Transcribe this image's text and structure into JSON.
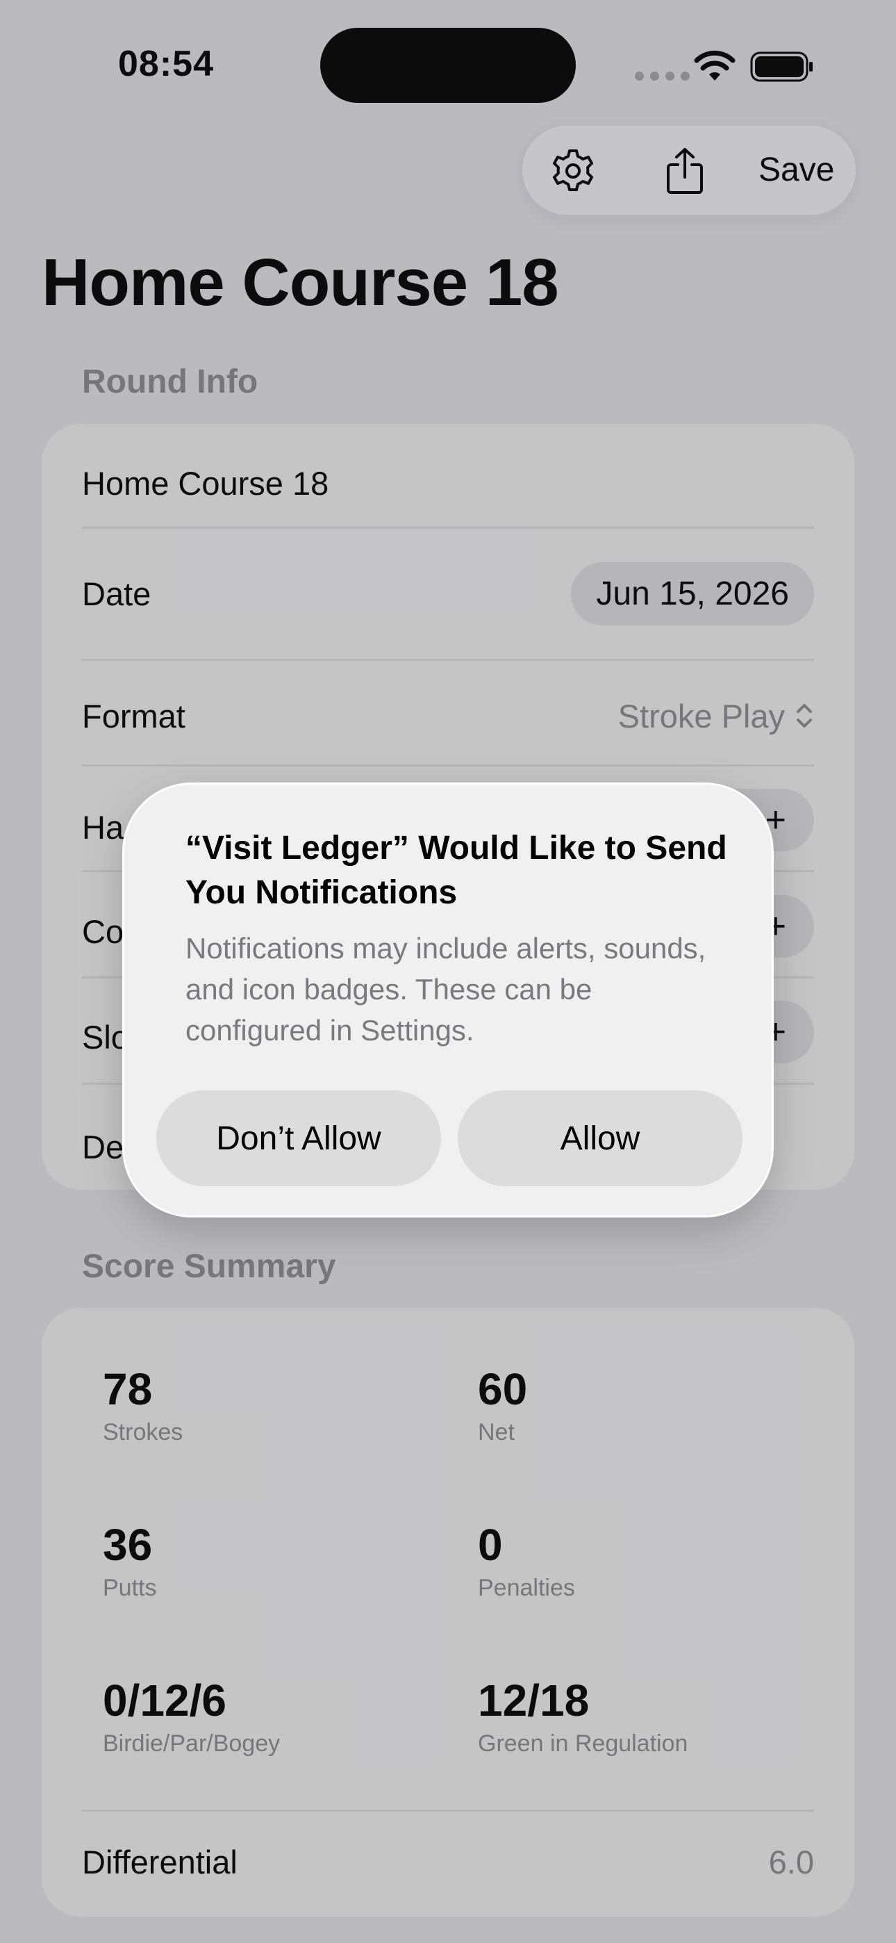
{
  "status": {
    "time": "08:54"
  },
  "toolbar": {
    "save_label": "Save"
  },
  "page": {
    "title": "Home Course 18"
  },
  "round_info": {
    "header": "Round Info",
    "name_value": "Home Course 18",
    "date_label": "Date",
    "date_value": "Jun 15, 2026",
    "format_label": "Format",
    "format_value": "Stroke Play",
    "row4_label": "Ha",
    "row5_label": "Co",
    "row6_label": "Slo",
    "row7_label": "De"
  },
  "score_summary": {
    "header": "Score Summary",
    "stats": [
      {
        "value": "78",
        "label": "Strokes"
      },
      {
        "value": "60",
        "label": "Net"
      },
      {
        "value": "36",
        "label": "Putts"
      },
      {
        "value": "0",
        "label": "Penalties"
      },
      {
        "value": "0/12/6",
        "label": "Birdie/Par/Bogey"
      },
      {
        "value": "12/18",
        "label": "Green in Regulation"
      }
    ],
    "differential_label": "Differential",
    "differential_value": "6.0"
  },
  "alert": {
    "title": "“Visit Ledger” Would Like to Send You Notifications",
    "message": "Notifications may include alerts, sounds, and icon badges. These can be configured in Settings.",
    "deny_label": "Don’t Allow",
    "allow_label": "Allow"
  },
  "icons": [
    "gear-icon",
    "share-icon",
    "wifi-icon",
    "battery-icon",
    "chevron-updown-icon"
  ]
}
